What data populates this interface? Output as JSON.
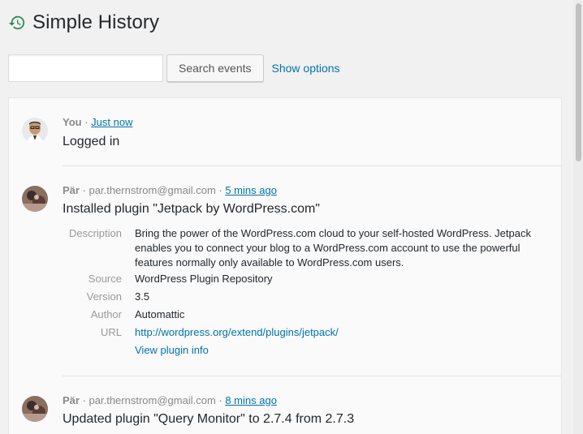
{
  "header": {
    "title": "Simple History",
    "logo_icon": "history-clock-icon",
    "accent": "#2e8b57"
  },
  "search": {
    "value": "",
    "placeholder": "",
    "button_label": "Search events",
    "show_options_label": "Show options"
  },
  "events": [
    {
      "who": "You",
      "separator": " · ",
      "email": "",
      "time": "Just now",
      "message": "Logged in"
    },
    {
      "who": "Pär",
      "separator": " · ",
      "email": "par.thernstrom@gmail.com",
      "separator2": " · ",
      "time": "5 mins ago",
      "message": "Installed plugin \"Jetpack by WordPress.com\"",
      "details": {
        "description_label": "Description",
        "description": "Bring the power of the WordPress.com cloud to your self-hosted WordPress. Jetpack enables you to connect your blog to a WordPress.com account to use the powerful features normally only available to WordPress.com users.",
        "source_label": "Source",
        "source": "WordPress Plugin Repository",
        "version_label": "Version",
        "version": "3.5",
        "author_label": "Author",
        "author": "Automattic",
        "url_label": "URL",
        "url": "http://wordpress.org/extend/plugins/jetpack/",
        "view_info_label": "View plugin info"
      }
    },
    {
      "who": "Pär",
      "separator": " · ",
      "email": "par.thernstrom@gmail.com",
      "separator2": " · ",
      "time": "8 mins ago",
      "message": "Updated plugin \"Query Monitor\" to 2.7.4 from 2.7.3"
    }
  ]
}
